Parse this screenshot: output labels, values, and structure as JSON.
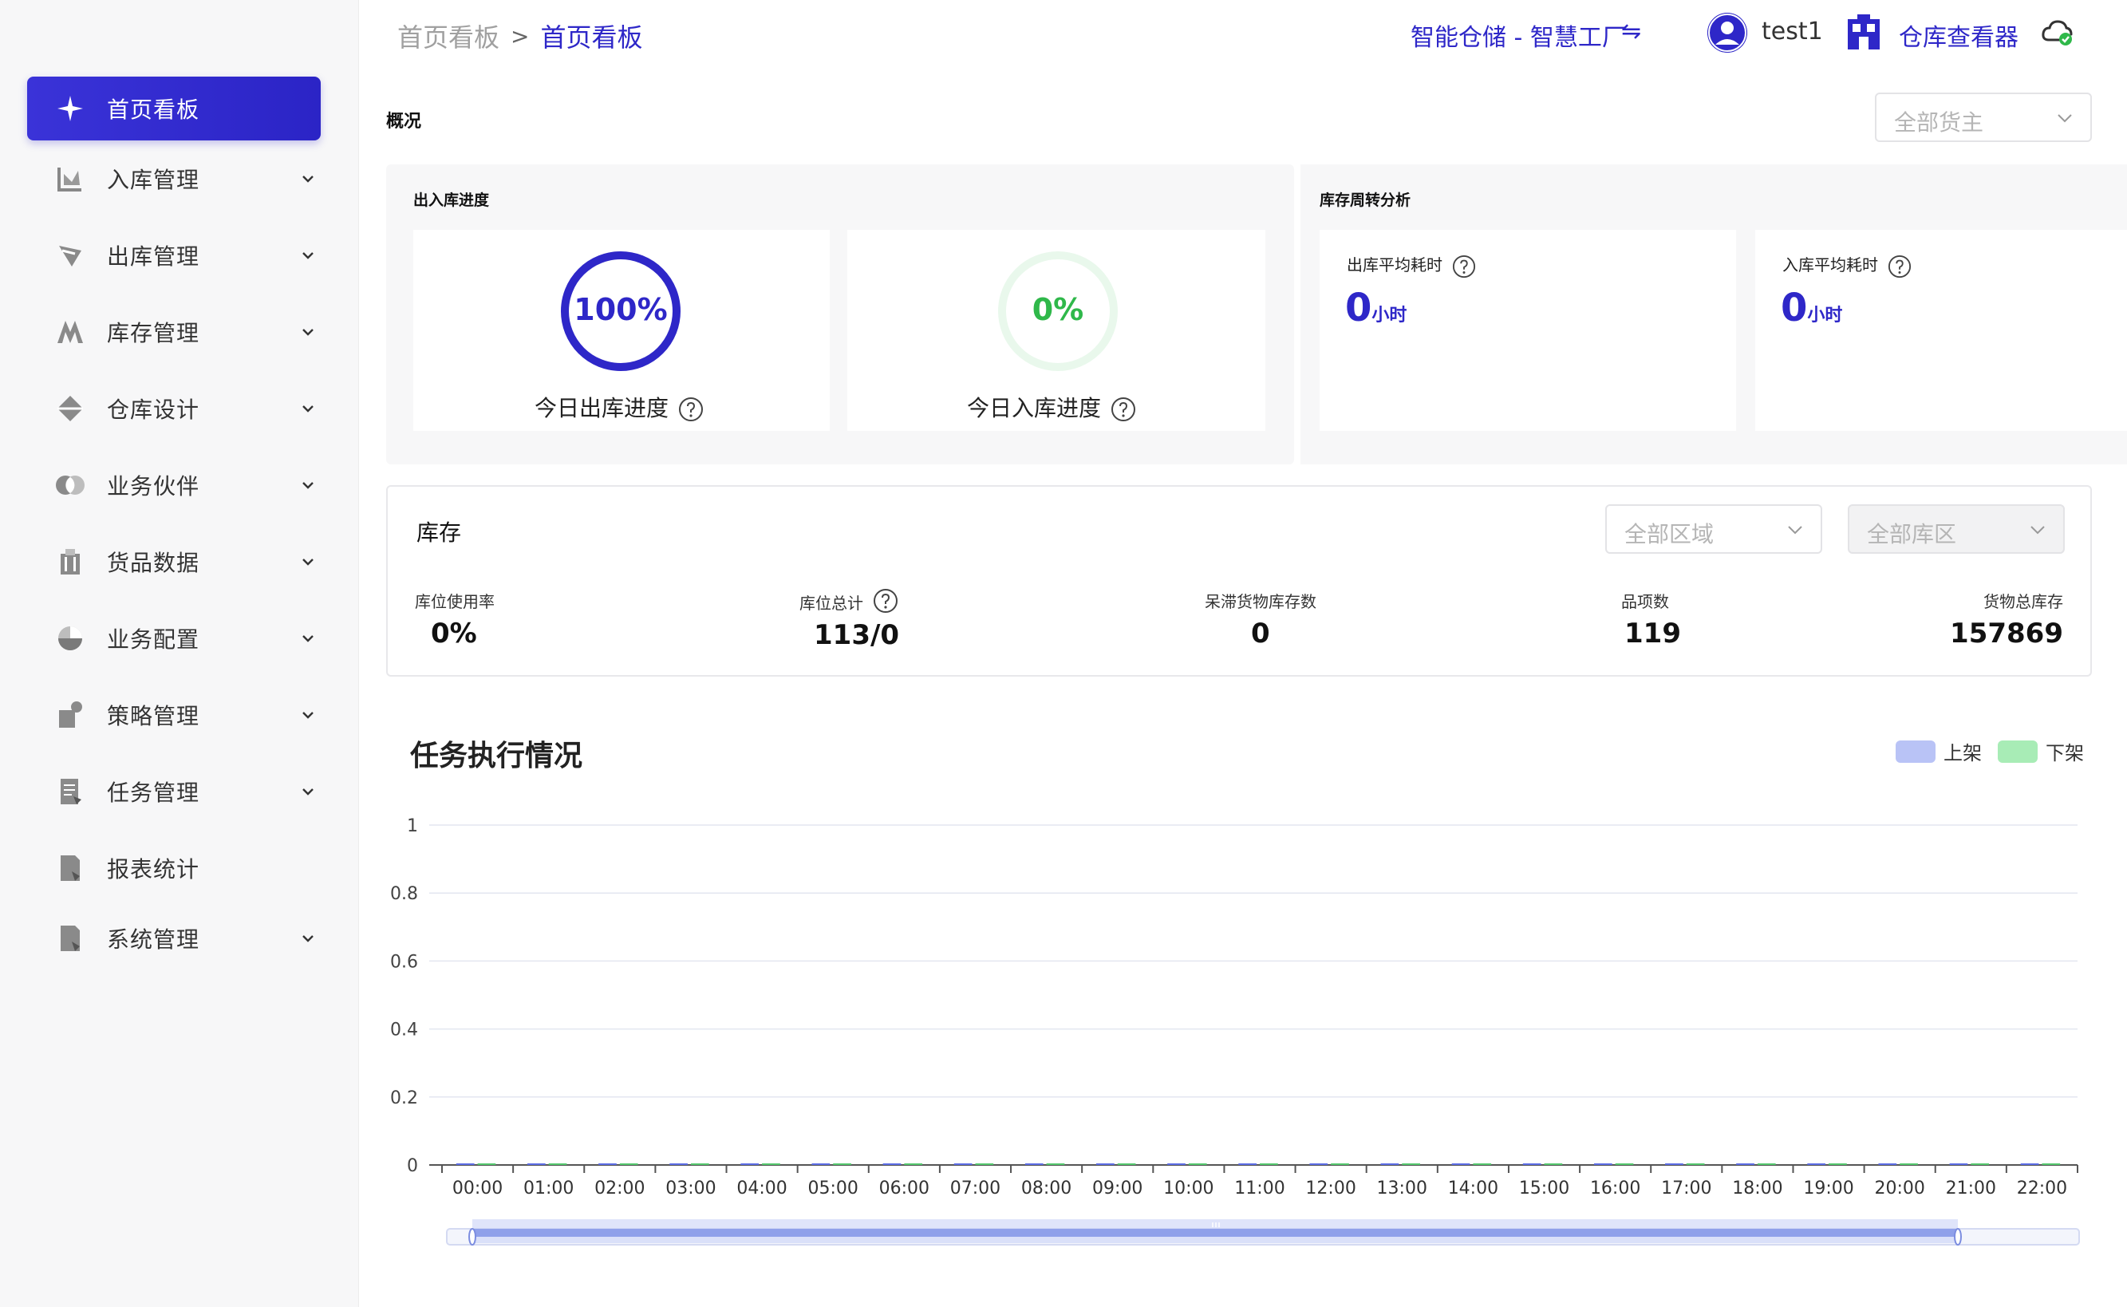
{
  "sidebar": {
    "items": [
      {
        "label": "首页看板",
        "icon": "sparkle-icon",
        "active": true,
        "has_children": false
      },
      {
        "label": "入库管理",
        "icon": "inbound-icon",
        "active": false,
        "has_children": true
      },
      {
        "label": "出库管理",
        "icon": "outbound-icon",
        "active": false,
        "has_children": true
      },
      {
        "label": "库存管理",
        "icon": "inventory-icon",
        "active": false,
        "has_children": true
      },
      {
        "label": "仓库设计",
        "icon": "warehouse-design-icon",
        "active": false,
        "has_children": true
      },
      {
        "label": "业务伙伴",
        "icon": "partner-icon",
        "active": false,
        "has_children": true
      },
      {
        "label": "货品数据",
        "icon": "goods-data-icon",
        "active": false,
        "has_children": true
      },
      {
        "label": "业务配置",
        "icon": "business-config-icon",
        "active": false,
        "has_children": true
      },
      {
        "label": "策略管理",
        "icon": "strategy-icon",
        "active": false,
        "has_children": true
      },
      {
        "label": "任务管理",
        "icon": "task-icon",
        "active": false,
        "has_children": true
      },
      {
        "label": "报表统计",
        "icon": "report-icon",
        "active": false,
        "has_children": false
      },
      {
        "label": "系统管理",
        "icon": "system-icon",
        "active": false,
        "has_children": true
      }
    ]
  },
  "header": {
    "breadcrumb_parent": "首页看板",
    "breadcrumb_sep": ">",
    "breadcrumb_current": "首页看板",
    "tenant": "智能仓储 - 智慧工厂",
    "switch_glyph": "⇋",
    "username": "test1",
    "viewer_label": "仓库查看器"
  },
  "overview": {
    "title": "概况",
    "owner_select": "全部货主",
    "progress_title": "出入库进度",
    "outbound_progress": {
      "value_text": "100%",
      "value": 100,
      "label": "今日出库进度"
    },
    "inbound_progress": {
      "value_text": "0%",
      "value": 0,
      "label": "今日入库进度"
    },
    "turnover_title": "库存周转分析",
    "outbound_avg": {
      "label": "出库平均耗时",
      "value": "0",
      "unit": "小时"
    },
    "inbound_avg": {
      "label": "入库平均耗时",
      "value": "0",
      "unit": "小时"
    }
  },
  "inventory": {
    "title": "库存",
    "area_select": "全部区域",
    "zone_select": "全部库区",
    "stats": [
      {
        "label": "库位使用率",
        "value": "0%"
      },
      {
        "label": "库位总计",
        "value": "113/0"
      },
      {
        "label": "呆滞货物库存数",
        "value": "0"
      },
      {
        "label": "品项数",
        "value": "119"
      },
      {
        "label": "货物总库存",
        "value": "157869"
      }
    ]
  },
  "tasks": {
    "title": "任务执行情况"
  },
  "colors": {
    "primary": "#2e27c8",
    "up_shelf": "#b9c3f6",
    "down_shelf": "#a8ecb6",
    "progress_green": "#2fb84a"
  },
  "chart_data": {
    "type": "bar",
    "categories": [
      "00:00",
      "01:00",
      "02:00",
      "03:00",
      "04:00",
      "05:00",
      "06:00",
      "07:00",
      "08:00",
      "09:00",
      "10:00",
      "11:00",
      "12:00",
      "13:00",
      "14:00",
      "15:00",
      "16:00",
      "17:00",
      "18:00",
      "19:00",
      "20:00",
      "21:00",
      "22:00"
    ],
    "series": [
      {
        "name": "上架",
        "values": [
          0,
          0,
          0,
          0,
          0,
          0,
          0,
          0,
          0,
          0,
          0,
          0,
          0,
          0,
          0,
          0,
          0,
          0,
          0,
          0,
          0,
          0,
          0
        ]
      },
      {
        "name": "下架",
        "values": [
          0,
          0,
          0,
          0,
          0,
          0,
          0,
          0,
          0,
          0,
          0,
          0,
          0,
          0,
          0,
          0,
          0,
          0,
          0,
          0,
          0,
          0,
          0
        ]
      }
    ],
    "y_ticks": [
      "1",
      "0.8",
      "0.6",
      "0.4",
      "0.2",
      "0"
    ],
    "ylim": [
      0,
      1
    ],
    "grid": true,
    "legend": "top-right",
    "xlabel": "",
    "ylabel": ""
  }
}
